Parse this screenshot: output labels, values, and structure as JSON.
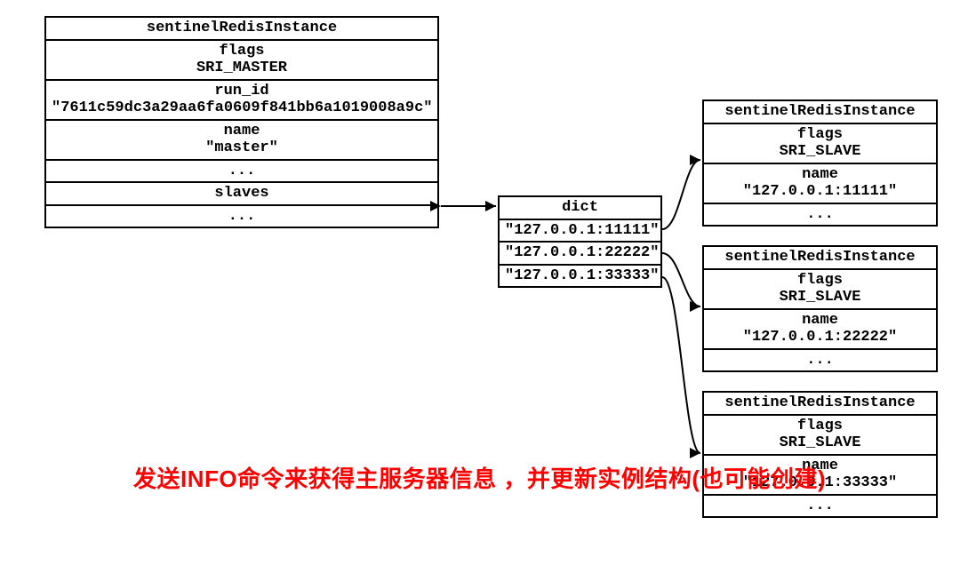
{
  "master": {
    "title": "sentinelRedisInstance",
    "flags_label": "flags",
    "flags_value": "SRI_MASTER",
    "runid_label": "run_id",
    "runid_value": "\"7611c59dc3a29aa6fa0609f841bb6a1019008a9c\"",
    "name_label": "name",
    "name_value": "\"master\"",
    "ellipsis1": "...",
    "slaves_label": "slaves",
    "ellipsis2": "..."
  },
  "dict": {
    "title": "dict",
    "entry1": "\"127.0.0.1:11111\"",
    "entry2": "\"127.0.0.1:22222\"",
    "entry3": "\"127.0.0.1:33333\""
  },
  "slave1": {
    "title": "sentinelRedisInstance",
    "flags_label": "flags",
    "flags_value": "SRI_SLAVE",
    "name_label": "name",
    "name_value": "\"127.0.0.1:11111\"",
    "ellipsis": "..."
  },
  "slave2": {
    "title": "sentinelRedisInstance",
    "flags_label": "flags",
    "flags_value": "SRI_SLAVE",
    "name_label": "name",
    "name_value": "\"127.0.0.1:22222\"",
    "ellipsis": "..."
  },
  "slave3": {
    "title": "sentinelRedisInstance",
    "flags_label": "flags",
    "flags_value": "SRI_SLAVE",
    "name_label": "name",
    "name_value": "\"127.0.0.1:33333\"",
    "ellipsis": "..."
  },
  "caption": {
    "line1": "发送INFO命令来获得主服务器信息",
    "line2": "，并更新实例结构(也可能创建)"
  }
}
